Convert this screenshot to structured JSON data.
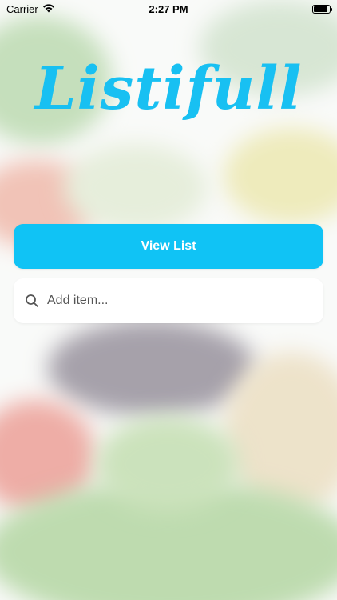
{
  "status_bar": {
    "carrier": "Carrier",
    "time": "2:27 PM",
    "battery_level": 0.9
  },
  "app": {
    "logo_text": "Listifull",
    "brand_color": "#18c0f2"
  },
  "actions": {
    "view_list_label": "View List"
  },
  "search": {
    "placeholder": "Add item...",
    "value": ""
  },
  "icons": {
    "wifi": "wifi-icon",
    "battery": "battery-icon",
    "search": "search-icon"
  }
}
